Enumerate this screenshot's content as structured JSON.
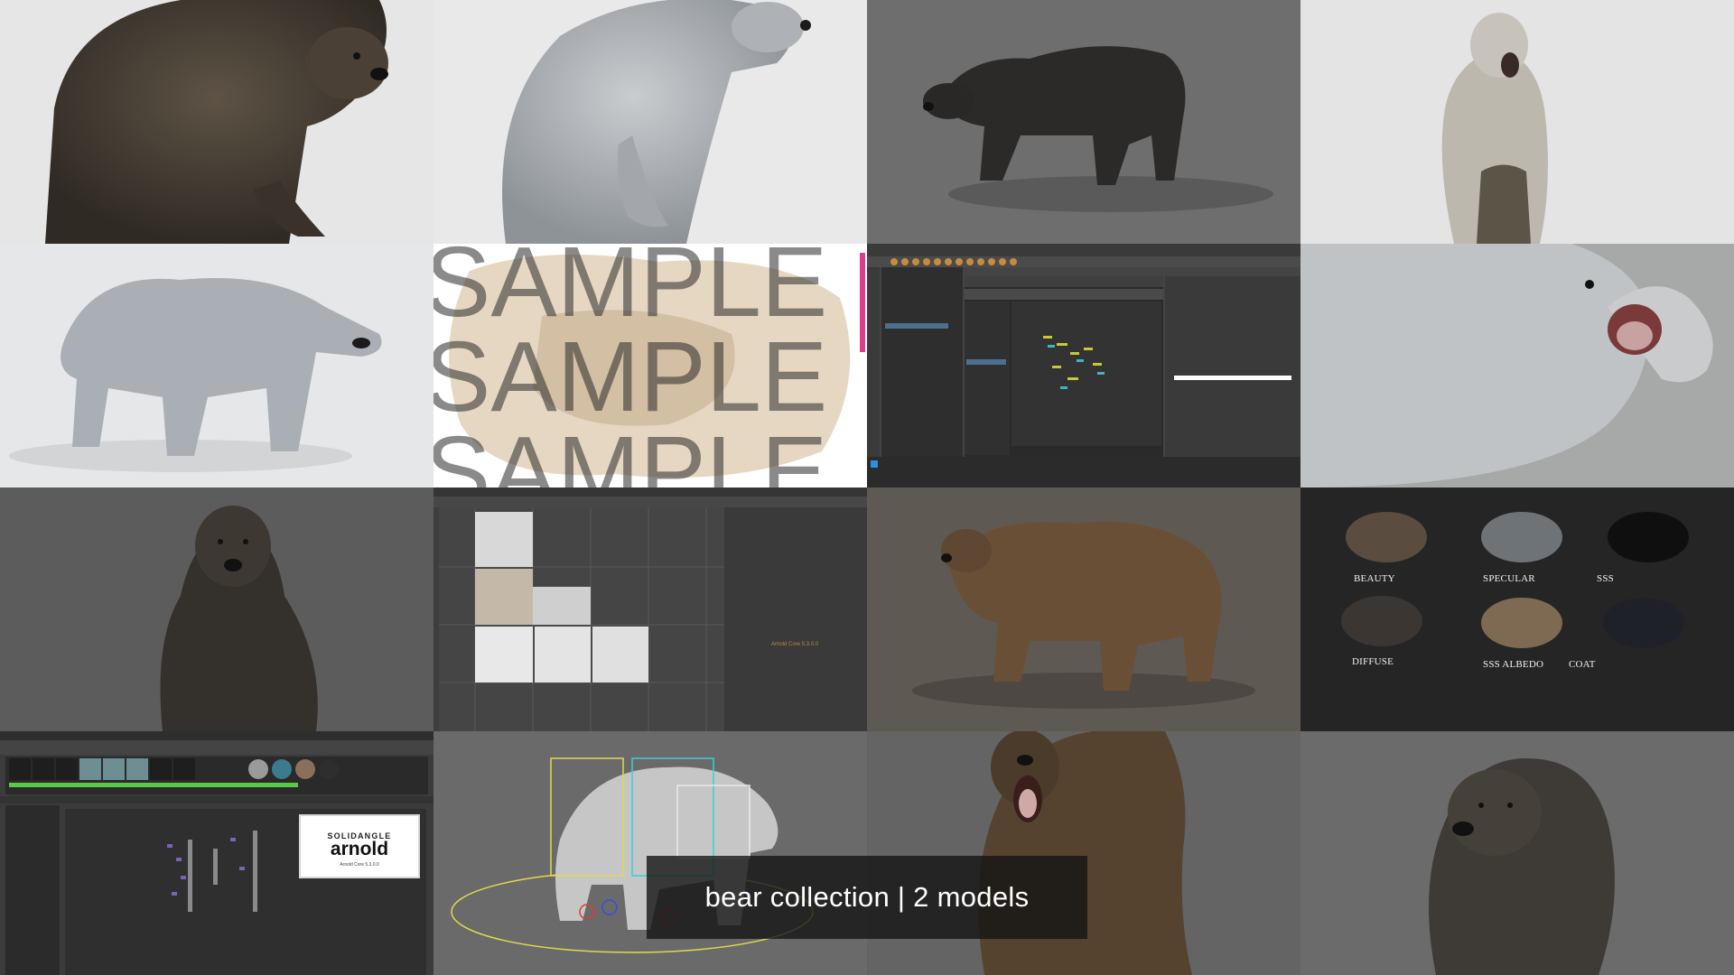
{
  "caption": "bear collection | 2 models",
  "render_passes": [
    "BEAUTY",
    "SPECULAR",
    "SSS",
    "DIFFUSE",
    "SSS ALBEDO",
    "COAT"
  ],
  "watermark_word": "SAMPLE",
  "arnold_logo": {
    "brand": "SOLIDANGLE",
    "name": "arnold",
    "version": "Arnold Core 5.3.0.0"
  },
  "uv_version_label": "Arnold Core 5.3.0.0",
  "colors": {
    "brown_bear": "#4a3f33",
    "polar_bear": "#b9bcbf",
    "studio_light": "#e7e8ea",
    "studio_grey": "#6c6c6c",
    "maya_ui": "#3c3c3c"
  }
}
